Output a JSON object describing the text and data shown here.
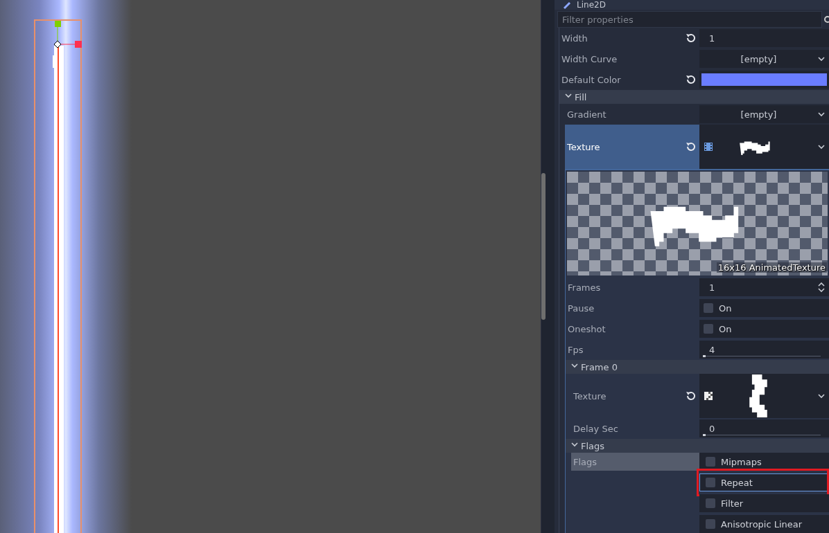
{
  "inspector": {
    "node_title": "Line2D",
    "filter": {
      "placeholder": "Filter properties"
    },
    "properties": [
      {
        "kind": "number",
        "label": "Width",
        "revertable": true,
        "value": "1"
      },
      {
        "kind": "resource",
        "label": "Width Curve",
        "revertable": false,
        "value": "[empty]"
      },
      {
        "kind": "color",
        "label": "Default Color",
        "revertable": true,
        "color": "#6a7dff"
      },
      {
        "kind": "section",
        "label": "Fill",
        "expanded": true,
        "children": [
          {
            "kind": "resource",
            "label": "Gradient",
            "revertable": false,
            "value": "[empty]"
          },
          {
            "kind": "animated_texture",
            "label": "Texture",
            "revertable": true,
            "highlighted": true,
            "expanded": true,
            "preview_caption": "16x16 AnimatedTexture",
            "children": [
              {
                "kind": "spin",
                "label": "Frames",
                "value": "1"
              },
              {
                "kind": "check",
                "label": "Pause",
                "text": "On",
                "checked": false
              },
              {
                "kind": "check",
                "label": "Oneshot",
                "text": "On",
                "checked": false
              },
              {
                "kind": "range",
                "label": "Fps",
                "value": "4",
                "level": 0.0
              },
              {
                "kind": "section",
                "label": "Frame 0",
                "expanded": true,
                "children": [
                  {
                    "kind": "image_texture",
                    "label": "Texture",
                    "revertable": true,
                    "highlighted": false
                  },
                  {
                    "kind": "range",
                    "label": "Delay Sec",
                    "value": "0",
                    "level": 0.0
                  }
                ]
              },
              {
                "kind": "section",
                "label": "Flags",
                "expanded": true,
                "children": [
                  {
                    "kind": "flags",
                    "label": "Flags",
                    "highlighted": true,
                    "flags": [
                      {
                        "label": "Mipmaps",
                        "checked": false,
                        "hovered": false
                      },
                      {
                        "label": "Repeat",
                        "checked": false,
                        "hovered": true
                      },
                      {
                        "label": "Filter",
                        "checked": false,
                        "hovered": false
                      },
                      {
                        "label": "Anisotropic Linear",
                        "checked": false,
                        "hovered": false
                      }
                    ]
                  }
                ]
              }
            ]
          }
        ]
      }
    ]
  }
}
